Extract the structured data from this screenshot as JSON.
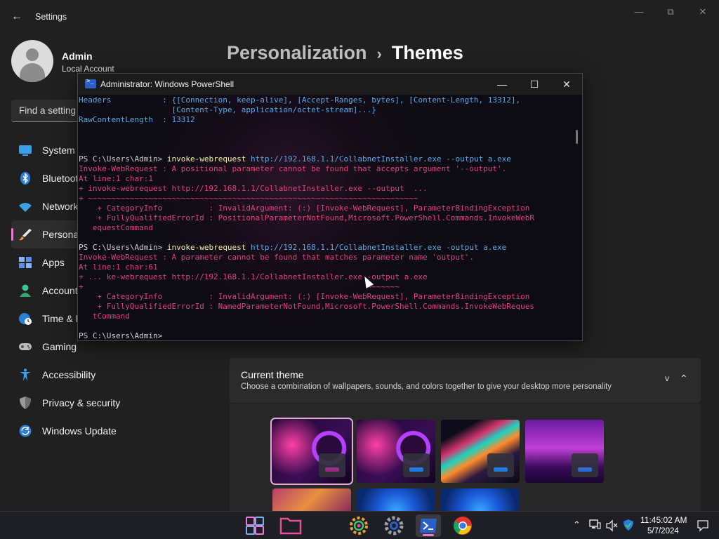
{
  "window": {
    "title": "Settings",
    "back_glyph": "←",
    "minimize_glyph": "—",
    "maximize_glyph": "⧉",
    "close_glyph": "✕"
  },
  "user": {
    "name": "Admin",
    "account_type": "Local Account"
  },
  "search": {
    "placeholder": "Find a setting"
  },
  "sidebar": {
    "items": [
      {
        "label": "System",
        "icon": "monitor-icon"
      },
      {
        "label": "Bluetooth & devices",
        "icon": "bluetooth-icon"
      },
      {
        "label": "Network & internet",
        "icon": "wifi-icon"
      },
      {
        "label": "Personalization",
        "icon": "brush-icon",
        "active": true
      },
      {
        "label": "Apps",
        "icon": "apps-icon"
      },
      {
        "label": "Accounts",
        "icon": "person-icon"
      },
      {
        "label": "Time & language",
        "icon": "globe-clock-icon"
      },
      {
        "label": "Gaming",
        "icon": "gamepad-icon"
      },
      {
        "label": "Accessibility",
        "icon": "accessibility-icon"
      },
      {
        "label": "Privacy & security",
        "icon": "shield-icon"
      },
      {
        "label": "Windows Update",
        "icon": "update-icon"
      }
    ]
  },
  "breadcrumb": {
    "parent": "Personalization",
    "separator": "›",
    "current": "Themes"
  },
  "current_theme": {
    "title": "Current theme",
    "subtitle": "Choose a combination of wallpapers, sounds, and colors together to give your desktop more personality",
    "v_label": "v",
    "chevron": "⌃"
  },
  "themes": [
    {
      "name": "theme-1",
      "accent": "#9b2d8a",
      "selected": true
    },
    {
      "name": "theme-2",
      "accent": "#1e7be0",
      "selected": false
    },
    {
      "name": "theme-3",
      "accent": "#1e7be0",
      "selected": false
    },
    {
      "name": "theme-4",
      "accent": "#2b6fd6",
      "selected": false
    }
  ],
  "powershell": {
    "title": "Administrator: Windows PowerShell",
    "minimize_glyph": "—",
    "maximize_glyph": "☐",
    "close_glyph": "✕",
    "lines": [
      {
        "text": "Headers           : {[Connection, keep-alive], [Accept-Ranges, bytes], [Content-Length, 13312],",
        "kind": "info"
      },
      {
        "text": "                    [Content-Type, application/octet-stream]...}",
        "kind": "info"
      },
      {
        "text": "RawContentLength  : 13312",
        "kind": "info"
      },
      {
        "text": "",
        "kind": "blank"
      },
      {
        "text": "",
        "kind": "blank"
      },
      {
        "text": "",
        "kind": "blank"
      },
      {
        "prompt": "PS C:\\Users\\Admin> ",
        "cmd": "invoke-webrequest",
        "args": " http://192.168.1.1/CollabnetInstaller.exe --output a.exe",
        "kind": "command"
      },
      {
        "text": "Invoke-WebRequest : A positional parameter cannot be found that accepts argument '--output'.",
        "kind": "err"
      },
      {
        "text": "At line:1 char:1",
        "kind": "err"
      },
      {
        "text": "+ invoke-webrequest http://192.168.1.1/CollabnetInstaller.exe --output  ...",
        "kind": "err"
      },
      {
        "text": "+ ~~~~~~~~~~~~~~~~~~~~~~~~~~~~~~~~~~~~~~~~~~~~~~~~~~~~~~~~~~~~~~~~~~~~~~~",
        "kind": "err"
      },
      {
        "text": "    + CategoryInfo          : InvalidArgument: (:) [Invoke-WebRequest], ParameterBindingException",
        "kind": "err"
      },
      {
        "text": "    + FullyQualifiedErrorId : PositionalParameterNotFound,Microsoft.PowerShell.Commands.InvokeWebR",
        "kind": "err"
      },
      {
        "text": "   equestCommand",
        "kind": "err"
      },
      {
        "text": "",
        "kind": "blank"
      },
      {
        "prompt": "PS C:\\Users\\Admin> ",
        "cmd": "invoke-webrequest",
        "args": " http://192.168.1.1/CollabnetInstaller.exe -output a.exe",
        "kind": "command"
      },
      {
        "text": "Invoke-WebRequest : A parameter cannot be found that matches parameter name 'output'.",
        "kind": "err"
      },
      {
        "text": "At line:1 char:61",
        "kind": "err"
      },
      {
        "text": "+ ... ke-webrequest http://192.168.1.1/CollabnetInstaller.exe -output a.exe",
        "kind": "err"
      },
      {
        "text": "+                                                             ~~~~~~~",
        "kind": "err"
      },
      {
        "text": "    + CategoryInfo          : InvalidArgument: (:) [Invoke-WebRequest], ParameterBindingException",
        "kind": "err"
      },
      {
        "text": "    + FullyQualifiedErrorId : NamedParameterNotFound,Microsoft.PowerShell.Commands.InvokeWebReques",
        "kind": "err"
      },
      {
        "text": "   tCommand",
        "kind": "err"
      },
      {
        "text": "",
        "kind": "blank"
      },
      {
        "text": "PS C:\\Users\\Admin>",
        "kind": "prompt"
      }
    ]
  },
  "taskbar": {
    "apps": [
      {
        "name": "start-button",
        "icon": "windows-icon"
      },
      {
        "name": "taskbar-file-explorer",
        "icon": "folder-icon"
      },
      {
        "name": "taskbar-settings-alt",
        "icon": "gear-color-icon"
      },
      {
        "name": "taskbar-settings",
        "icon": "gear-icon"
      },
      {
        "name": "taskbar-powershell",
        "icon": "powershell-icon",
        "active": true
      },
      {
        "name": "taskbar-chrome",
        "icon": "chrome-icon"
      }
    ],
    "tray": {
      "chevron": "⌃",
      "time": "11:45:02 AM",
      "date": "5/7/2024"
    }
  }
}
